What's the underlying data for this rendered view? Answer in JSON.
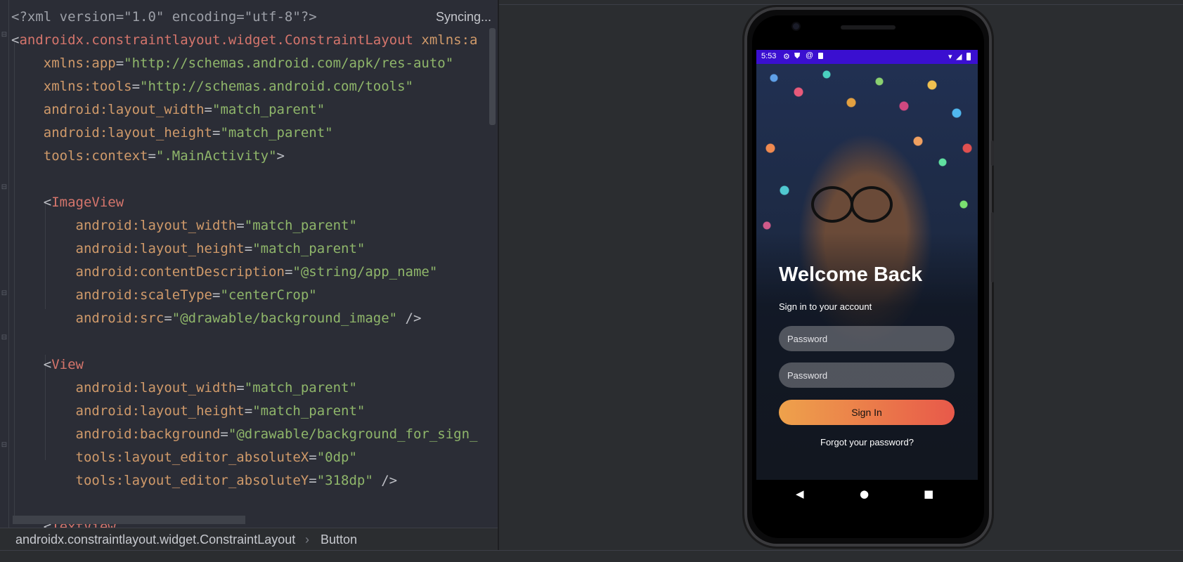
{
  "editor": {
    "status": "Syncing...",
    "lines": [
      [
        {
          "c": "t-decl",
          "t": "<?xml version=\"1.0\" encoding=\"utf-8\"?>"
        }
      ],
      [
        {
          "c": "t-punc",
          "t": "<"
        },
        {
          "c": "t-tag",
          "t": "androidx.constraintlayout.widget.ConstraintLayout "
        },
        {
          "c": "t-attr",
          "t": "xmlns:a"
        }
      ],
      [
        {
          "c": "t-attr",
          "t": "    xmlns:app"
        },
        {
          "c": "t-punc",
          "t": "="
        },
        {
          "c": "t-val",
          "t": "\"http://schemas.android.com/apk/res-auto\""
        }
      ],
      [
        {
          "c": "t-attr",
          "t": "    xmlns:tools"
        },
        {
          "c": "t-punc",
          "t": "="
        },
        {
          "c": "t-val",
          "t": "\"http://schemas.android.com/tools\""
        }
      ],
      [
        {
          "c": "t-attr",
          "t": "    android:layout_width"
        },
        {
          "c": "t-punc",
          "t": "="
        },
        {
          "c": "t-val",
          "t": "\"match_parent\""
        }
      ],
      [
        {
          "c": "t-attr",
          "t": "    android:layout_height"
        },
        {
          "c": "t-punc",
          "t": "="
        },
        {
          "c": "t-val",
          "t": "\"match_parent\""
        }
      ],
      [
        {
          "c": "t-attr",
          "t": "    tools:context"
        },
        {
          "c": "t-punc",
          "t": "="
        },
        {
          "c": "t-val",
          "t": "\".MainActivity\""
        },
        {
          "c": "t-punc",
          "t": ">"
        }
      ],
      [
        {
          "c": "t-punc",
          "t": ""
        }
      ],
      [
        {
          "c": "t-punc",
          "t": "    <"
        },
        {
          "c": "t-tag",
          "t": "ImageView"
        }
      ],
      [
        {
          "c": "t-attr",
          "t": "        android:layout_width"
        },
        {
          "c": "t-punc",
          "t": "="
        },
        {
          "c": "t-val",
          "t": "\"match_parent\""
        }
      ],
      [
        {
          "c": "t-attr",
          "t": "        android:layout_height"
        },
        {
          "c": "t-punc",
          "t": "="
        },
        {
          "c": "t-val",
          "t": "\"match_parent\""
        }
      ],
      [
        {
          "c": "t-attr",
          "t": "        android:contentDescription"
        },
        {
          "c": "t-punc",
          "t": "="
        },
        {
          "c": "t-val",
          "t": "\"@string/app_name\""
        }
      ],
      [
        {
          "c": "t-attr",
          "t": "        android:scaleType"
        },
        {
          "c": "t-punc",
          "t": "="
        },
        {
          "c": "t-val",
          "t": "\"centerCrop\""
        }
      ],
      [
        {
          "c": "t-attr",
          "t": "        android:src"
        },
        {
          "c": "t-punc",
          "t": "="
        },
        {
          "c": "t-val",
          "t": "\"@drawable/background_image\""
        },
        {
          "c": "t-punc",
          "t": " />"
        }
      ],
      [
        {
          "c": "t-punc",
          "t": ""
        }
      ],
      [
        {
          "c": "t-punc",
          "t": "    <"
        },
        {
          "c": "t-tag",
          "t": "View"
        }
      ],
      [
        {
          "c": "t-attr",
          "t": "        android:layout_width"
        },
        {
          "c": "t-punc",
          "t": "="
        },
        {
          "c": "t-val",
          "t": "\"match_parent\""
        }
      ],
      [
        {
          "c": "t-attr",
          "t": "        android:layout_height"
        },
        {
          "c": "t-punc",
          "t": "="
        },
        {
          "c": "t-val",
          "t": "\"match_parent\""
        }
      ],
      [
        {
          "c": "t-attr",
          "t": "        android:background"
        },
        {
          "c": "t-punc",
          "t": "="
        },
        {
          "c": "t-val",
          "t": "\"@drawable/background_for_sign_"
        }
      ],
      [
        {
          "c": "t-attr",
          "t": "        tools:layout_editor_absoluteX"
        },
        {
          "c": "t-punc",
          "t": "="
        },
        {
          "c": "t-val",
          "t": "\"0dp\""
        }
      ],
      [
        {
          "c": "t-attr",
          "t": "        tools:layout_editor_absoluteY"
        },
        {
          "c": "t-punc",
          "t": "="
        },
        {
          "c": "t-val",
          "t": "\"318dp\""
        },
        {
          "c": "t-punc",
          "t": " />"
        }
      ],
      [
        {
          "c": "t-punc",
          "t": ""
        }
      ],
      [
        {
          "c": "t-punc",
          "t": "    <"
        },
        {
          "c": "t-tag",
          "t": "TextView"
        }
      ]
    ]
  },
  "breadcrumb": {
    "root": "androidx.constraintlayout.widget.ConstraintLayout",
    "separator": "›",
    "leaf": "Button"
  },
  "device": {
    "status_time": "5:53",
    "status_icons": [
      "gear-icon",
      "shield-icon",
      "at-icon",
      "sim-icon"
    ],
    "right_icons": [
      "wifi-icon",
      "signal-icon",
      "battery-icon"
    ],
    "welcome_title": "Welcome Back",
    "subtitle": "Sign in to your account",
    "field1_placeholder": "Password",
    "field2_placeholder": "Password",
    "signin_label": "Sign In",
    "forgot_label": "Forgot your password?",
    "nav": {
      "back": "◀",
      "home": "●",
      "recents": "■"
    },
    "status_bar_color": "#3a0fd0",
    "button_gradient": [
      "#eea24b",
      "#e8594a"
    ]
  }
}
